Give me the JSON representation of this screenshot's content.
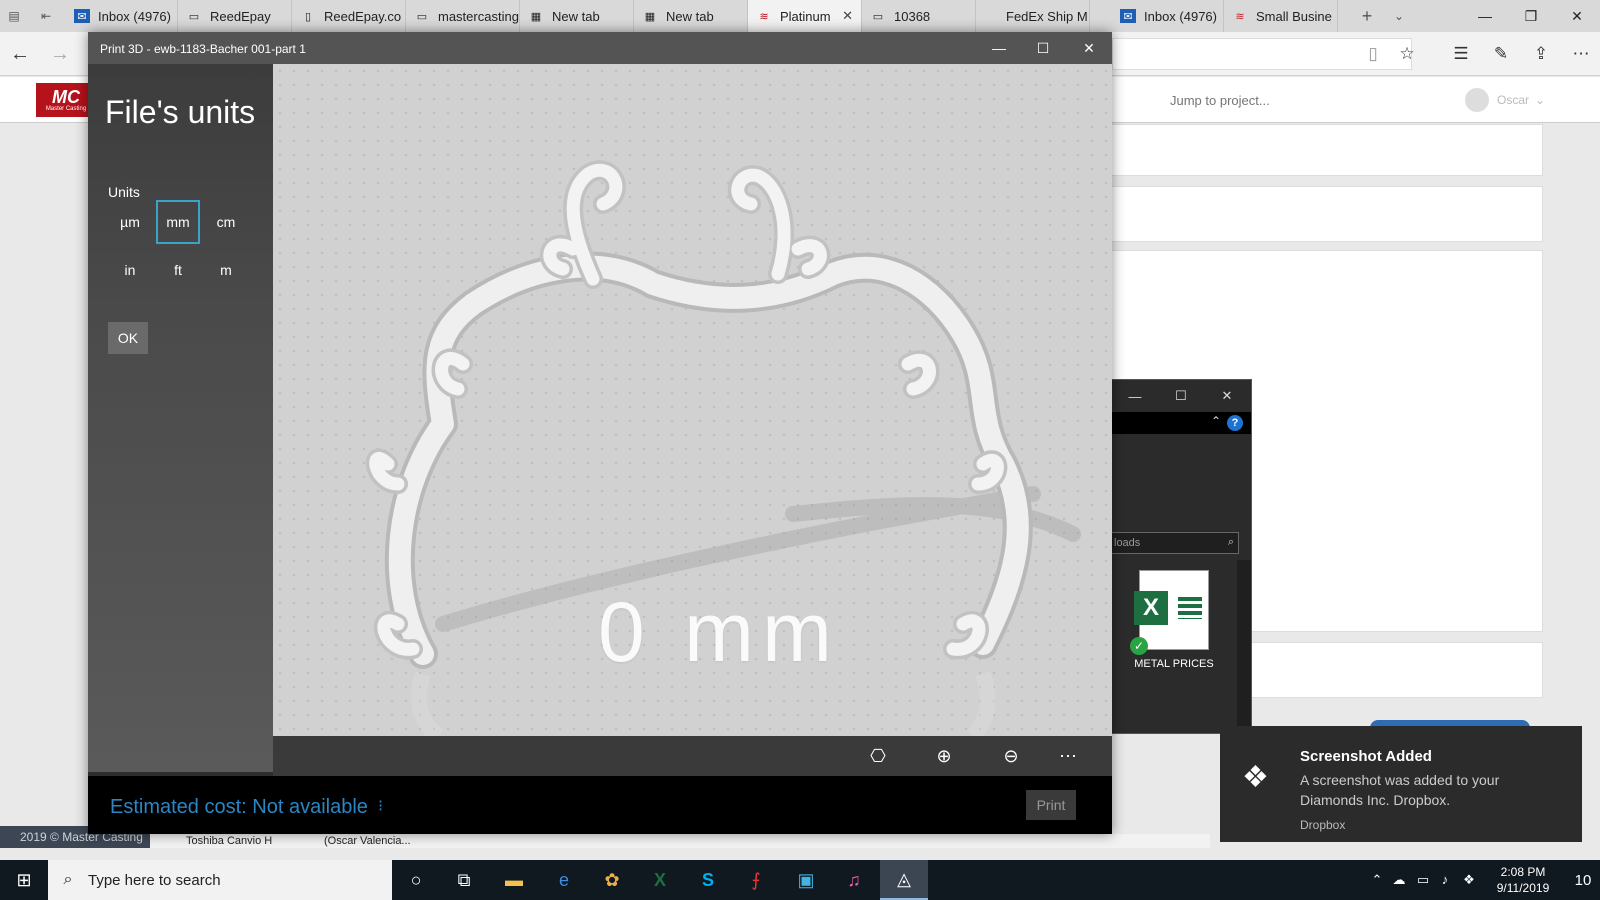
{
  "browser": {
    "tabs": [
      {
        "label": "Inbox (4976)",
        "icon": "outlook-icon",
        "active": false
      },
      {
        "label": "ReedEpay",
        "icon": "page-icon",
        "active": false
      },
      {
        "label": "ReedEpay.co",
        "icon": "doc-icon",
        "active": false
      },
      {
        "label": "mastercasting",
        "icon": "page-icon",
        "active": false
      },
      {
        "label": "New tab",
        "icon": "newtab-icon",
        "active": false
      },
      {
        "label": "New tab",
        "icon": "newtab-icon",
        "active": false
      },
      {
        "label": "Platinum",
        "icon": "brand-icon",
        "active": true
      },
      {
        "label": "10368",
        "icon": "page-icon",
        "active": false
      },
      {
        "label": "FedEx Ship M",
        "icon": "none",
        "active": false
      },
      {
        "label": "Inbox (4976)",
        "icon": "outlook-icon",
        "active": false
      },
      {
        "label": "Small Busine",
        "icon": "brand-icon",
        "active": false
      }
    ]
  },
  "site": {
    "search_placeholder": "Jump to project...",
    "user_name": "Oscar",
    "footer": "2019 © Master Casting"
  },
  "explorer": {
    "search_partial": "loads",
    "file_name": "METAL PRICES",
    "status_items": [
      "Toshiba Canvio H",
      "(Oscar Valencia..."
    ]
  },
  "print3d": {
    "window_title": "Print 3D - ewb-1183-Bacher 001-part 1",
    "panel_title": "File's units",
    "units_label": "Units",
    "units": [
      "µm",
      "mm",
      "cm",
      "in",
      "ft",
      "m"
    ],
    "selected_unit": "mm",
    "ok_label": "OK",
    "dimension_readout": "0 mm",
    "estimated_cost": "Estimated cost: Not available",
    "print_label": "Print"
  },
  "toast": {
    "title": "Screenshot Added",
    "body": "A screenshot was added to your Diamonds Inc. Dropbox.",
    "source": "Dropbox"
  },
  "taskbar": {
    "search_placeholder": "Type here to search",
    "time": "2:08 PM",
    "date": "9/11/2019",
    "notification_count": "10"
  },
  "colors": {
    "accent": "#2b86c3",
    "selection_border": "#3aa3c9",
    "viewport": "#d1d1d1",
    "brand_red": "#b5121b"
  }
}
